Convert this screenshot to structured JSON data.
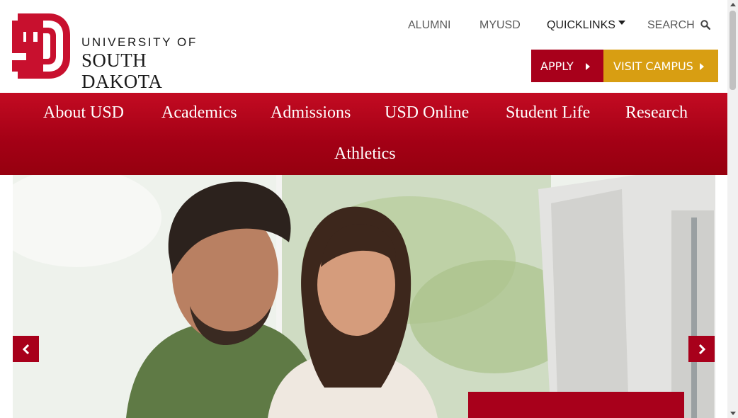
{
  "brand": {
    "line1": "UNIVERSITY OF",
    "line2": "SOUTH DAKOTA",
    "logo_icon": "usd-sd-logo",
    "red": "#a8001b",
    "gold": "#d89e12"
  },
  "utility_nav": {
    "alumni": "ALUMNI",
    "myusd": "MYUSD",
    "quicklinks": "QUICKLINKS",
    "search": "SEARCH"
  },
  "cta": {
    "apply": "APPLY",
    "visit": "VISIT CAMPUS"
  },
  "main_nav": {
    "items": [
      {
        "label": "About USD"
      },
      {
        "label": "Academics"
      },
      {
        "label": "Admissions"
      },
      {
        "label": "USD Online"
      },
      {
        "label": "Student Life"
      },
      {
        "label": "Research"
      },
      {
        "label": "Athletics"
      }
    ]
  },
  "hero": {
    "image": "two-students-smiling-at-computer"
  }
}
